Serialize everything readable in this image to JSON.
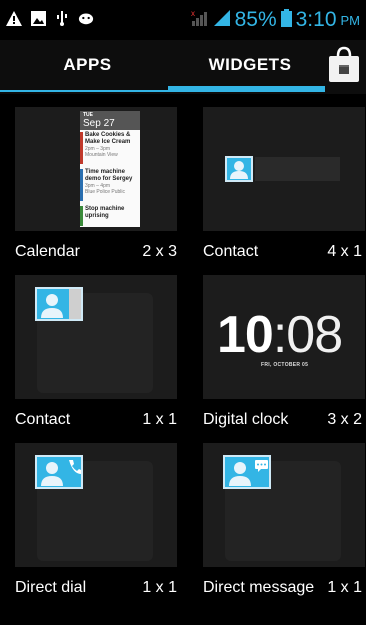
{
  "status_bar": {
    "battery_percent": "85%",
    "time": "3:10",
    "ampm": "PM",
    "icons": [
      "warning-icon",
      "image-icon",
      "usb-icon",
      "android-debug-icon",
      "no-signal-icon",
      "signal-icon",
      "battery-icon"
    ]
  },
  "tabs": {
    "apps": "APPS",
    "widgets": "WIDGETS",
    "active": "WIDGETS"
  },
  "widgets": [
    {
      "label": "Calendar",
      "size": "2 x 3"
    },
    {
      "label": "Contact",
      "size": "4 x 1"
    },
    {
      "label": "Contact",
      "size": "1 x 1"
    },
    {
      "label": "Digital clock",
      "size": "3 x 2"
    },
    {
      "label": "Direct dial",
      "size": "1 x 1"
    },
    {
      "label": "Direct message",
      "size": "1 x 1"
    }
  ],
  "calendar_preview": {
    "day_short": "TUE",
    "date": "Sep 27",
    "events": [
      {
        "title": "Bake Cookies & Make Ice Cream",
        "time": "2pm – 3pm",
        "place": "Mountain View"
      },
      {
        "title": "Time machine demo for Sergey",
        "time": "3pm – 4pm",
        "place": "Blue Police Public"
      },
      {
        "title": "Stop machine uprising",
        "time": "",
        "place": ""
      }
    ]
  },
  "clock_preview": {
    "hour": "10",
    "colon": ":",
    "minutes": "08",
    "date": "FRI, OCTOBER 05"
  },
  "colors": {
    "accent": "#33b5e5",
    "tile_bg": "#1c1c1c"
  }
}
